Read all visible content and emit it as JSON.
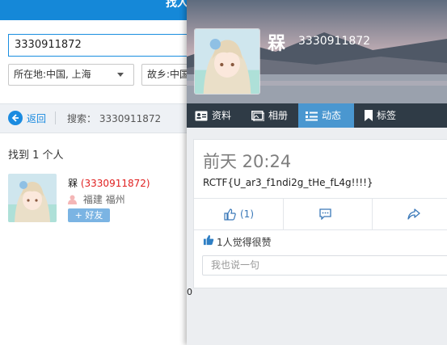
{
  "search_window": {
    "title_fragment": "找人",
    "search_value": "3330911872",
    "location_select": "所在地:中国, 上海",
    "hometown_select": "故乡:中国",
    "back_label": "返回",
    "search_label": "搜索： 3330911872",
    "result_count": "找到 1 个人",
    "result": {
      "nickname": "槑",
      "qq": "(3330911872)",
      "location": "福建 福州",
      "add_button": "+ 好友"
    }
  },
  "profile_window": {
    "nickname": "槑",
    "qq_number": "3330911872",
    "tabs": [
      {
        "label": "资料",
        "icon": "profile-card-icon",
        "active": false
      },
      {
        "label": "相册",
        "icon": "album-icon",
        "active": false
      },
      {
        "label": "动态",
        "icon": "list-icon",
        "active": true
      },
      {
        "label": "标签",
        "icon": "bookmark-icon",
        "active": false
      }
    ],
    "post": {
      "time": "前天 20:24",
      "content": "RCTF{U_ar3_f1ndi2g_tHe_fL4g!!!!}",
      "like_count": "(1)",
      "likes_text": "1人觉得很赞",
      "comment_placeholder": "我也说一句"
    },
    "stray_text": "0"
  },
  "colors": {
    "accent": "#1588d8",
    "tab_bar": "#2f3b46",
    "active_tab": "#4a97d0",
    "qq_red": "#e02020"
  }
}
